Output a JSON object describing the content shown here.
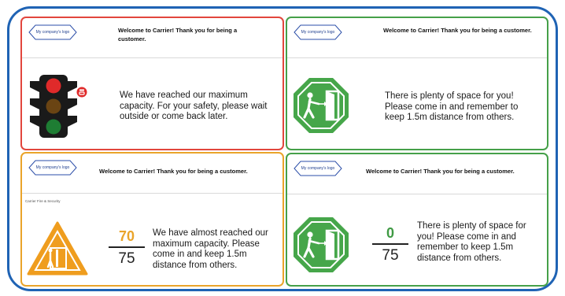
{
  "panels": {
    "full": {
      "logo": "My company's logo",
      "welcome": "Welcome to Carrier! Thank you for being a customer.",
      "message": "We have reached our maximum capacity. For your safety, please wait outside or come back later.",
      "icon": "traffic-light-icon",
      "accent": "#e2463d"
    },
    "space": {
      "logo": "My company's logo",
      "welcome": "Welcome to Carrier! Thank you for being a customer.",
      "message": "There is plenty of space for you! Please come in and remember to keep 1.5m distance from others.",
      "icon": "enter-door-icon",
      "accent": "#45a049"
    },
    "almost": {
      "logo": "My company's logo",
      "welcome": "Welcome to Carrier! Thank you for being a customer.",
      "subtitle": "Carrier Fire & Security",
      "count": "70",
      "capacity": "75",
      "message": "We have almost reached our maximum capacity. Please come in and keep 1.5m distance from others.",
      "icon": "warning-door-icon",
      "accent": "#eaa42a"
    },
    "empty": {
      "logo": "My company's logo",
      "welcome": "Welcome to Carrier! Thank you for being a customer.",
      "count": "0",
      "capacity": "75",
      "message": "There is plenty of space for you! Please come in and remember to keep 1.5m distance from others.",
      "icon": "enter-door-icon",
      "accent": "#45a049"
    }
  },
  "colors": {
    "frame": "#1f63b4",
    "red": "#e2463d",
    "green": "#45a049",
    "orange": "#eaa42a"
  }
}
